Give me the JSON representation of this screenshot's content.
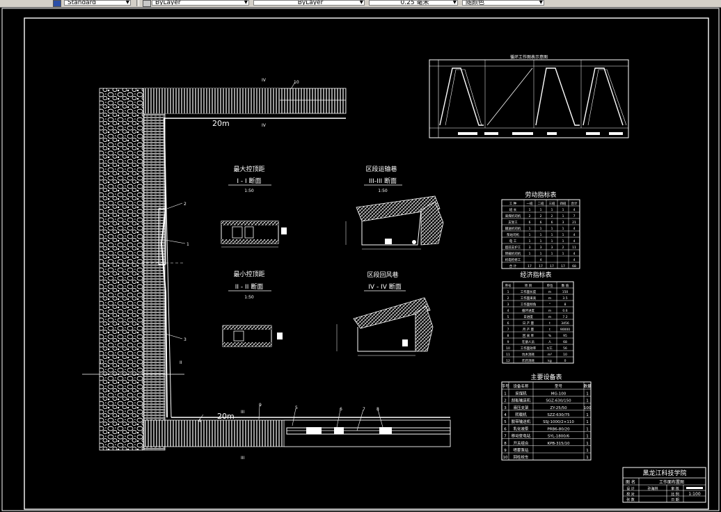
{
  "toolbar": {
    "style_value": "Standard",
    "layer_value": "ByLayer",
    "linetype_value": "ByLayer",
    "lineweight_value": "0.25 毫米",
    "color_value": "随颜色"
  },
  "drawing": {
    "length_top": "20m",
    "length_bottom": "20m",
    "mark_ii_top": "IV",
    "mark_iv_top": "IV",
    "mark_iii": "III",
    "mark_iii_bottom": "III",
    "mark_ii_left": "II",
    "mark_ii_right": "II",
    "callouts": [
      "1",
      "2",
      "3",
      "4",
      "5",
      "6",
      "7",
      "8",
      "9",
      "10"
    ]
  },
  "sections": {
    "max_title": "最大控顶距",
    "max_sub": "I - I 断面",
    "min_title": "最小控顶距",
    "min_sub": "II - II 断面",
    "scale": "1:50",
    "haul_title": "区段运输巷",
    "haul_sub": "III-III 断面",
    "return_title": "区段回风巷",
    "return_sub": "IV - IV 断面"
  },
  "cycle_chart": {
    "title": "循环工作图表示意图"
  },
  "labor_table": {
    "title": "劳动指标表",
    "headers": [
      "工 种",
      "一班",
      "二班",
      "三班",
      "四班",
      "合计"
    ],
    "rows": [
      [
        "班 长",
        "1",
        "1",
        "1",
        "1",
        "4"
      ],
      [
        "采煤机司机",
        "2",
        "2",
        "2",
        "1",
        "7"
      ],
      [
        "支架工",
        "6",
        "6",
        "6",
        "3",
        "21"
      ],
      [
        "输送机司机",
        "1",
        "1",
        "1",
        "1",
        "4"
      ],
      [
        "泵站司机",
        "1",
        "1",
        "1",
        "1",
        "4"
      ],
      [
        "电 工",
        "1",
        "1",
        "1",
        "1",
        "4"
      ],
      [
        "超前支护工",
        "3",
        "3",
        "3",
        "2",
        "11"
      ],
      [
        "转载机司机",
        "1",
        "1",
        "1",
        "1",
        "4"
      ],
      [
        "机电检修工",
        "",
        "4",
        "",
        "",
        "4"
      ],
      [
        "合 计",
        "17",
        "17",
        "17",
        "17",
        "68"
      ]
    ]
  },
  "econ_table": {
    "title": "经济指标表",
    "headers": [
      "序号",
      "项 目",
      "单位",
      "数 值"
    ],
    "rows": [
      [
        "1",
        "工作面长度",
        "m",
        "150"
      ],
      [
        "2",
        "工作面采高",
        "m",
        "3.5"
      ],
      [
        "3",
        "工作面倾角",
        "°",
        "8"
      ],
      [
        "4",
        "循环进度",
        "m",
        "0.6"
      ],
      [
        "5",
        "日进度",
        "m",
        "7.2"
      ],
      [
        "6",
        "日 产 量",
        "t",
        "3456"
      ],
      [
        "7",
        "月 产 量",
        "t",
        "90000"
      ],
      [
        "8",
        "回 采 率",
        "%",
        "95"
      ],
      [
        "9",
        "在册人员",
        "人",
        "68"
      ],
      [
        "10",
        "工作面效率",
        "t/工",
        "56"
      ],
      [
        "11",
        "坑木消耗",
        "m³",
        "10"
      ],
      [
        "12",
        "炸药消耗",
        "kg",
        "0"
      ]
    ]
  },
  "equip_table": {
    "title": "主要设备表",
    "headers": [
      "序号",
      "设备名称",
      "型号",
      "数量"
    ],
    "rows": [
      [
        "1",
        "采煤机",
        "MG-100",
        "1"
      ],
      [
        "2",
        "刮板输送机",
        "SGZ-630/150",
        "1"
      ],
      [
        "3",
        "液压支架",
        "ZY-25/50",
        "100"
      ],
      [
        "4",
        "转载机",
        "SZZ-630/75",
        "1"
      ],
      [
        "5",
        "胶带输送机",
        "SSJ-1000/2×110",
        "1"
      ],
      [
        "6",
        "乳化液泵",
        "PRB6-80/20",
        "1"
      ],
      [
        "7",
        "移动变电站",
        "SYL-1800/6",
        "1"
      ],
      [
        "8",
        "开关组合",
        "KPB-315/10",
        "1"
      ],
      [
        "9",
        "喷雾泵站",
        "",
        "1"
      ],
      [
        "10",
        "回柱绞车",
        "",
        "1"
      ]
    ]
  },
  "title_block": {
    "school": "黑龙江科技学院",
    "drawing_name_label": "图 名",
    "drawing_name": "工作面布置图",
    "design_label": "设 计",
    "designer": "孙海林",
    "review_label": "审 核",
    "scale_label": "比 例",
    "scale": "1:100",
    "date_label": "日 期",
    "check_label": "校 对",
    "sheet_label": "张 数"
  }
}
